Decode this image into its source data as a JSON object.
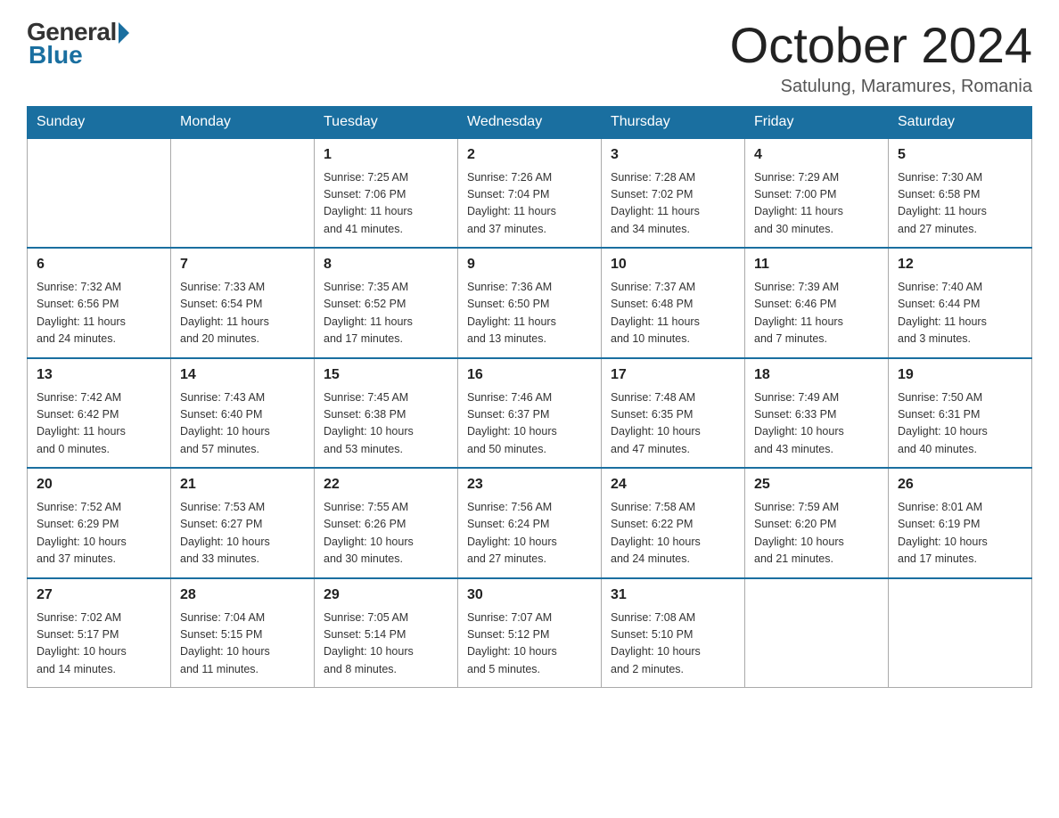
{
  "logo": {
    "general": "General",
    "blue": "Blue"
  },
  "title": "October 2024",
  "location": "Satulung, Maramures, Romania",
  "weekdays": [
    "Sunday",
    "Monday",
    "Tuesday",
    "Wednesday",
    "Thursday",
    "Friday",
    "Saturday"
  ],
  "weeks": [
    [
      {
        "day": "",
        "info": ""
      },
      {
        "day": "",
        "info": ""
      },
      {
        "day": "1",
        "info": "Sunrise: 7:25 AM\nSunset: 7:06 PM\nDaylight: 11 hours\nand 41 minutes."
      },
      {
        "day": "2",
        "info": "Sunrise: 7:26 AM\nSunset: 7:04 PM\nDaylight: 11 hours\nand 37 minutes."
      },
      {
        "day": "3",
        "info": "Sunrise: 7:28 AM\nSunset: 7:02 PM\nDaylight: 11 hours\nand 34 minutes."
      },
      {
        "day": "4",
        "info": "Sunrise: 7:29 AM\nSunset: 7:00 PM\nDaylight: 11 hours\nand 30 minutes."
      },
      {
        "day": "5",
        "info": "Sunrise: 7:30 AM\nSunset: 6:58 PM\nDaylight: 11 hours\nand 27 minutes."
      }
    ],
    [
      {
        "day": "6",
        "info": "Sunrise: 7:32 AM\nSunset: 6:56 PM\nDaylight: 11 hours\nand 24 minutes."
      },
      {
        "day": "7",
        "info": "Sunrise: 7:33 AM\nSunset: 6:54 PM\nDaylight: 11 hours\nand 20 minutes."
      },
      {
        "day": "8",
        "info": "Sunrise: 7:35 AM\nSunset: 6:52 PM\nDaylight: 11 hours\nand 17 minutes."
      },
      {
        "day": "9",
        "info": "Sunrise: 7:36 AM\nSunset: 6:50 PM\nDaylight: 11 hours\nand 13 minutes."
      },
      {
        "day": "10",
        "info": "Sunrise: 7:37 AM\nSunset: 6:48 PM\nDaylight: 11 hours\nand 10 minutes."
      },
      {
        "day": "11",
        "info": "Sunrise: 7:39 AM\nSunset: 6:46 PM\nDaylight: 11 hours\nand 7 minutes."
      },
      {
        "day": "12",
        "info": "Sunrise: 7:40 AM\nSunset: 6:44 PM\nDaylight: 11 hours\nand 3 minutes."
      }
    ],
    [
      {
        "day": "13",
        "info": "Sunrise: 7:42 AM\nSunset: 6:42 PM\nDaylight: 11 hours\nand 0 minutes."
      },
      {
        "day": "14",
        "info": "Sunrise: 7:43 AM\nSunset: 6:40 PM\nDaylight: 10 hours\nand 57 minutes."
      },
      {
        "day": "15",
        "info": "Sunrise: 7:45 AM\nSunset: 6:38 PM\nDaylight: 10 hours\nand 53 minutes."
      },
      {
        "day": "16",
        "info": "Sunrise: 7:46 AM\nSunset: 6:37 PM\nDaylight: 10 hours\nand 50 minutes."
      },
      {
        "day": "17",
        "info": "Sunrise: 7:48 AM\nSunset: 6:35 PM\nDaylight: 10 hours\nand 47 minutes."
      },
      {
        "day": "18",
        "info": "Sunrise: 7:49 AM\nSunset: 6:33 PM\nDaylight: 10 hours\nand 43 minutes."
      },
      {
        "day": "19",
        "info": "Sunrise: 7:50 AM\nSunset: 6:31 PM\nDaylight: 10 hours\nand 40 minutes."
      }
    ],
    [
      {
        "day": "20",
        "info": "Sunrise: 7:52 AM\nSunset: 6:29 PM\nDaylight: 10 hours\nand 37 minutes."
      },
      {
        "day": "21",
        "info": "Sunrise: 7:53 AM\nSunset: 6:27 PM\nDaylight: 10 hours\nand 33 minutes."
      },
      {
        "day": "22",
        "info": "Sunrise: 7:55 AM\nSunset: 6:26 PM\nDaylight: 10 hours\nand 30 minutes."
      },
      {
        "day": "23",
        "info": "Sunrise: 7:56 AM\nSunset: 6:24 PM\nDaylight: 10 hours\nand 27 minutes."
      },
      {
        "day": "24",
        "info": "Sunrise: 7:58 AM\nSunset: 6:22 PM\nDaylight: 10 hours\nand 24 minutes."
      },
      {
        "day": "25",
        "info": "Sunrise: 7:59 AM\nSunset: 6:20 PM\nDaylight: 10 hours\nand 21 minutes."
      },
      {
        "day": "26",
        "info": "Sunrise: 8:01 AM\nSunset: 6:19 PM\nDaylight: 10 hours\nand 17 minutes."
      }
    ],
    [
      {
        "day": "27",
        "info": "Sunrise: 7:02 AM\nSunset: 5:17 PM\nDaylight: 10 hours\nand 14 minutes."
      },
      {
        "day": "28",
        "info": "Sunrise: 7:04 AM\nSunset: 5:15 PM\nDaylight: 10 hours\nand 11 minutes."
      },
      {
        "day": "29",
        "info": "Sunrise: 7:05 AM\nSunset: 5:14 PM\nDaylight: 10 hours\nand 8 minutes."
      },
      {
        "day": "30",
        "info": "Sunrise: 7:07 AM\nSunset: 5:12 PM\nDaylight: 10 hours\nand 5 minutes."
      },
      {
        "day": "31",
        "info": "Sunrise: 7:08 AM\nSunset: 5:10 PM\nDaylight: 10 hours\nand 2 minutes."
      },
      {
        "day": "",
        "info": ""
      },
      {
        "day": "",
        "info": ""
      }
    ]
  ]
}
